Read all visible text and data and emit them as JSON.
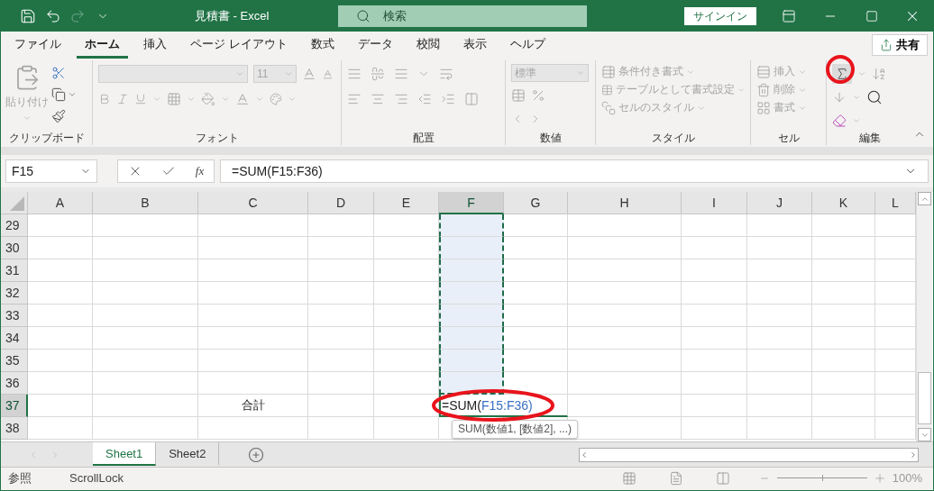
{
  "title_bar": {
    "title": "見積書  -  Excel",
    "search_placeholder": "検索",
    "sign_in": "サインイン"
  },
  "menu_tabs": [
    {
      "label": "ファイル",
      "selected": false
    },
    {
      "label": "ホーム",
      "selected": true
    },
    {
      "label": "挿入",
      "selected": false
    },
    {
      "label": "ページ レイアウト",
      "selected": false
    },
    {
      "label": "数式",
      "selected": false
    },
    {
      "label": "データ",
      "selected": false
    },
    {
      "label": "校閲",
      "selected": false
    },
    {
      "label": "表示",
      "selected": false
    },
    {
      "label": "ヘルプ",
      "selected": false
    }
  ],
  "share": "共有",
  "ribbon": {
    "disabled": true,
    "clipboard": {
      "label": "クリップボード",
      "paste": "貼り付け"
    },
    "font": {
      "label": "フォント",
      "font_size": "11"
    },
    "alignment": {
      "label": "配置"
    },
    "number": {
      "label": "数値",
      "format": "標準"
    },
    "styles": {
      "label": "スタイル",
      "items": [
        "条件付き書式",
        "テーブルとして書式設定",
        "セルのスタイル"
      ]
    },
    "cells": {
      "label": "セル",
      "items": [
        "挿入",
        "削除",
        "書式"
      ]
    },
    "editing": {
      "label": "編集"
    }
  },
  "formula_bar": {
    "name_box": "F15",
    "function_label": "fx",
    "formula": "=SUM(F15:F36)"
  },
  "columns": [
    {
      "label": "A",
      "selected": false
    },
    {
      "label": "B",
      "selected": false
    },
    {
      "label": "C",
      "selected": false
    },
    {
      "label": "D",
      "selected": false
    },
    {
      "label": "E",
      "selected": false
    },
    {
      "label": "F",
      "selected": true
    },
    {
      "label": "G",
      "selected": false
    },
    {
      "label": "H",
      "selected": false
    },
    {
      "label": "I",
      "selected": false
    },
    {
      "label": "J",
      "selected": false
    },
    {
      "label": "K",
      "selected": false
    },
    {
      "label": "L",
      "selected": false
    }
  ],
  "rows": [
    {
      "label": "29",
      "selected": false,
      "in_range": true
    },
    {
      "label": "30",
      "selected": false,
      "in_range": true
    },
    {
      "label": "31",
      "selected": false,
      "in_range": true
    },
    {
      "label": "32",
      "selected": false,
      "in_range": true
    },
    {
      "label": "33",
      "selected": false,
      "in_range": true
    },
    {
      "label": "34",
      "selected": false,
      "in_range": true
    },
    {
      "label": "35",
      "selected": false,
      "in_range": true
    },
    {
      "label": "36",
      "selected": false,
      "in_range": true
    },
    {
      "label": "37",
      "selected": true,
      "in_range": false,
      "column_c": "合計",
      "editing": {
        "prefix": "=SUM(",
        "reference": "F15:F36)",
        "hint": "SUM(数値1, [数値2], ...)"
      }
    },
    {
      "label": "38",
      "selected": false,
      "in_range": false
    }
  ],
  "sheet_tabs": [
    {
      "label": "Sheet1",
      "selected": true
    },
    {
      "label": "Sheet2",
      "selected": false
    }
  ],
  "status_bar": {
    "mode": "参照",
    "scroll_lock": "ScrollLock",
    "zoom": "100%",
    "zoom_slider": {
      "level": 0.5
    }
  }
}
